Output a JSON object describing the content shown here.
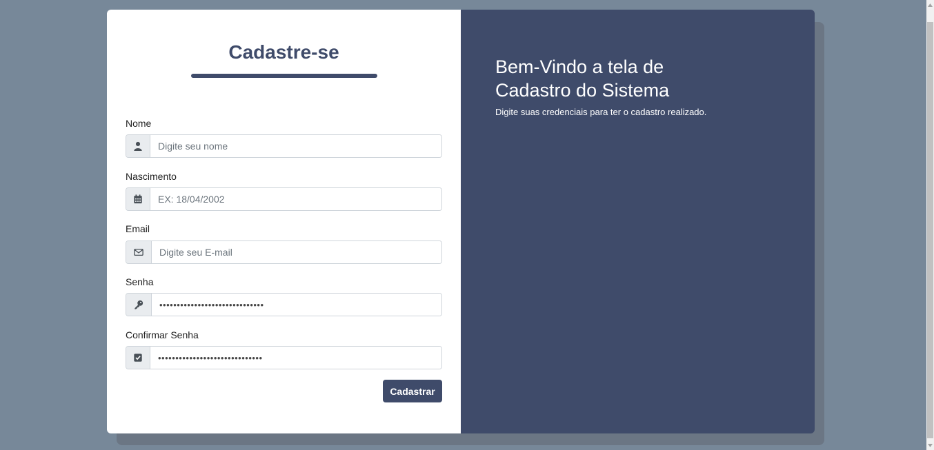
{
  "form": {
    "title": "Cadastre-se",
    "fields": [
      {
        "label": "Nome",
        "placeholder": "Digite seu nome",
        "icon": "user-icon"
      },
      {
        "label": "Nascimento",
        "placeholder": "EX: 18/04/2002",
        "icon": "calendar-icon"
      },
      {
        "label": "Email",
        "placeholder": "Digite seu E-mail",
        "icon": "envelope-icon"
      },
      {
        "label": "Senha",
        "value": "••••••••••••••••••••••••••••••",
        "icon": "key-icon"
      },
      {
        "label": "Confirmar Senha",
        "value": "••••••••••••••••••••••••••••••",
        "icon": "check-square-icon"
      }
    ],
    "submit_label": "Cadastrar"
  },
  "welcome": {
    "title": "Bem-Vindo a tela de Cadastro do Sistema",
    "subtitle": "Digite suas credenciais para ter o cadastro realizado."
  },
  "colors": {
    "page_background": "#778899",
    "accent": "#3f4b6a",
    "card_background": "#ffffff"
  }
}
